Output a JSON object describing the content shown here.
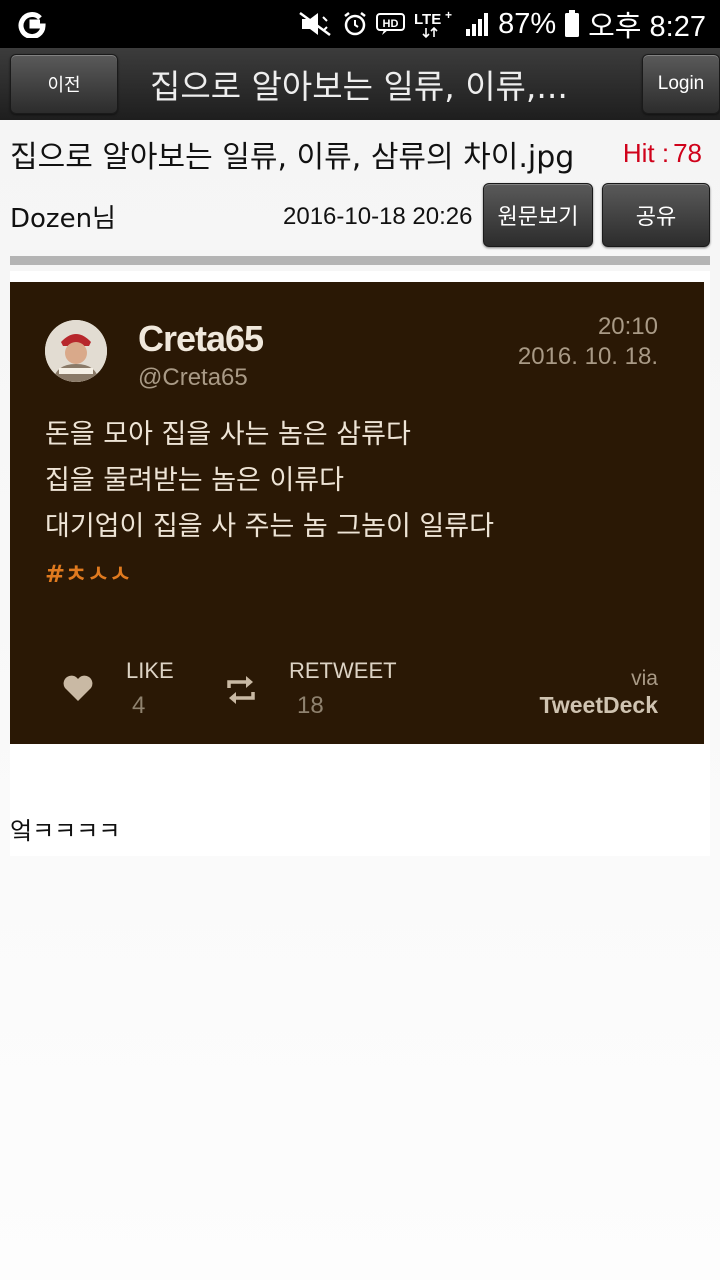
{
  "status_bar": {
    "battery": "87%",
    "time": "오후 8:27",
    "network": "LTE",
    "icons": [
      "app-g-icon",
      "mute-icon",
      "alarm-icon",
      "hd-voice-icon",
      "lte-icon",
      "signal-icon",
      "battery-icon"
    ]
  },
  "toolbar": {
    "prev_label": "이전",
    "title": "집으로 알아보는 일류, 이류,...",
    "login_label": "Login"
  },
  "post": {
    "title": "집으로 알아보는 일류, 이류, 삼류의 차이.jpg",
    "hit_label": "Hit :",
    "hit_count": "78",
    "author": "Dozen님",
    "date": "2016-10-18 20:26",
    "original_label": "원문보기",
    "share_label": "공유"
  },
  "tweet": {
    "name": "Creta65",
    "handle": "@Creta65",
    "time": "20:10",
    "date": "2016. 10. 18.",
    "lines": [
      "돈을 모아 집을 사는 놈은 삼류다",
      "집을 물려받는 놈은 이류다",
      "대기업이 집을 사 주는 놈 그놈이 일류다"
    ],
    "hashtag": "#ㅊㅅㅅ",
    "like_label": "LIKE",
    "like_count": "4",
    "retweet_label": "RETWEET",
    "retweet_count": "18",
    "via_label": "via",
    "via_app": "TweetDeck"
  },
  "comment": "엌ㅋㅋㅋㅋ",
  "colors": {
    "hit": "#d0021b",
    "tweet_bg": "#2a1805",
    "hashtag": "#e07a1f"
  }
}
